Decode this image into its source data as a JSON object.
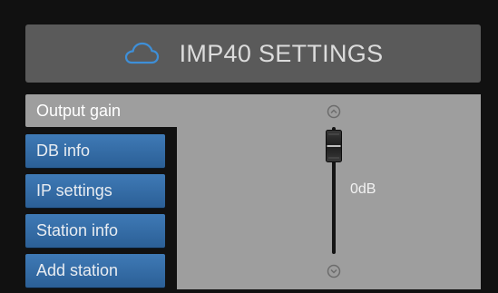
{
  "header": {
    "title": "IMP40 SETTINGS",
    "icon": "cloud-icon"
  },
  "tabs": [
    {
      "label": "Output gain",
      "active": true
    },
    {
      "label": "DB info",
      "active": false
    },
    {
      "label": "IP settings",
      "active": false
    },
    {
      "label": "Station info",
      "active": false
    },
    {
      "label": "Add station",
      "active": false
    }
  ],
  "gain": {
    "value_label": "0dB",
    "level_percent": 85
  },
  "colors": {
    "accent": "#3f7ab6",
    "header_bg": "#5a5a5a",
    "panel_bg": "#9e9e9e",
    "cloud": "#3e8fd8"
  }
}
